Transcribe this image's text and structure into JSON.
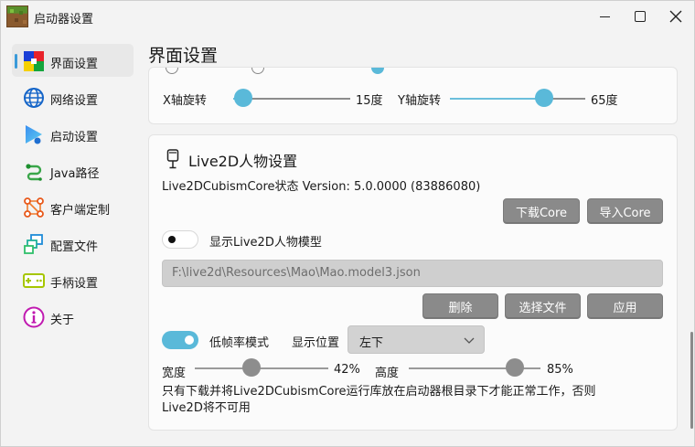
{
  "window": {
    "title": "启动器设置"
  },
  "sidebar": {
    "items": [
      {
        "label": "界面设置",
        "icon": "color-blocks-icon"
      },
      {
        "label": "网络设置",
        "icon": "globe-icon"
      },
      {
        "label": "启动设置",
        "icon": "play-icon"
      },
      {
        "label": "Java路径",
        "icon": "path-icon"
      },
      {
        "label": "客户端定制",
        "icon": "nodes-icon"
      },
      {
        "label": "配置文件",
        "icon": "files-icon"
      },
      {
        "label": "手柄设置",
        "icon": "gamepad-icon"
      },
      {
        "label": "关于",
        "icon": "info-icon"
      }
    ],
    "active_index": 0
  },
  "page": {
    "title": "界面设置"
  },
  "rotation": {
    "x_label": "X轴旋转",
    "x_value": "15度",
    "x_level": 0.15,
    "y_label": "Y轴旋转",
    "y_value": "65度",
    "y_level": 0.65
  },
  "live2d": {
    "section_title": "Live2D人物设置",
    "core_status": "Live2DCubismCore状态  Version: 5.0.0000 (83886080)",
    "download_core_label": "下载Core",
    "import_core_label": "导入Core",
    "show_model_label": "显示Live2D人物模型",
    "show_model_on": false,
    "model_path": "F:\\live2d\\Resources\\Mao\\Mao.model3.json",
    "delete_label": "删除",
    "choose_file_label": "选择文件",
    "apply_label": "应用",
    "low_fps_label": "低帧率模式",
    "low_fps_on": true,
    "position_label": "显示位置",
    "position_value": "左下",
    "width_label": "宽度",
    "width_value": "42%",
    "width_level": 0.42,
    "height_label": "高度",
    "height_value": "85%",
    "height_level": 0.85,
    "note": "只有下载并将Live2DCubismCore运行库放在启动器根目录下才能正常工作，否则Live2D将不可用"
  },
  "colors": {
    "accent": "#5ab9d9",
    "button_gray": "#8a8a8a"
  }
}
